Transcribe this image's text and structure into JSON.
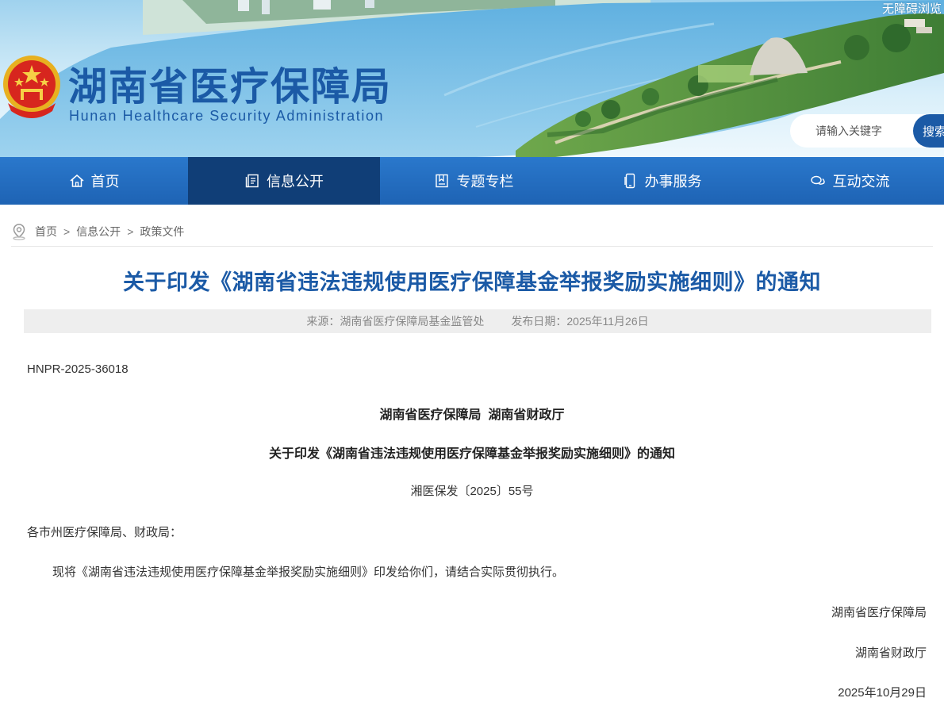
{
  "header": {
    "site_title": "湖南省医疗保障局",
    "site_subtitle": "Hunan Healthcare Security Administration",
    "accessibility_link": "无障碍浏览",
    "search_placeholder": "请输入关键字",
    "search_button": "搜索"
  },
  "nav": {
    "items": [
      {
        "label": "首页",
        "icon": "home-icon"
      },
      {
        "label": "信息公开",
        "icon": "document-list-icon",
        "active": true
      },
      {
        "label": "专题专栏",
        "icon": "book-icon"
      },
      {
        "label": "办事服务",
        "icon": "phone-icon"
      },
      {
        "label": "互动交流",
        "icon": "chat-icon"
      }
    ]
  },
  "breadcrumb": {
    "items": [
      "首页",
      "信息公开",
      "政策文件"
    ],
    "separator": ">"
  },
  "article": {
    "title": "关于印发《湖南省违法违规使用医疗保障基金举报奖励实施细则》的通知",
    "source": "来源：湖南省医疗保障局基金监管处",
    "publish_date": "发布日期：2025年11月26日",
    "doc_number": "HNPR-2025-36018",
    "issuers": "湖南省医疗保障局  湖南省财政厅",
    "doc_title": "关于印发《湖南省违法违规使用医疗保障基金举报奖励实施细则》的通知",
    "doc_code": "湘医保发〔2025〕55号",
    "recipients": "各市州医疗保障局、财政局：",
    "paragraph": "现将《湖南省违法违规使用医疗保障基金举报奖励实施细则》印发给你们，请结合实际贯彻执行。",
    "signature_1": "湖南省医疗保障局",
    "signature_2": "湖南省财政厅",
    "signature_date": "2025年10月29日"
  },
  "colors": {
    "brand_blue": "#1b5aa6",
    "nav_blue": "#2a78cc",
    "nav_active": "#103e77",
    "meta_bg": "#eeeeee"
  }
}
